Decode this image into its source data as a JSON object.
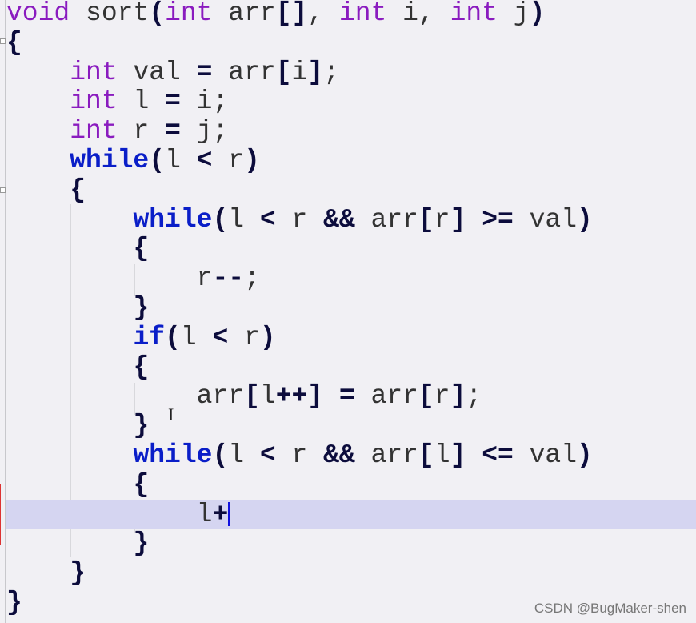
{
  "editor": {
    "current_line": 17,
    "colors": {
      "background": "#f1f0f4",
      "type_keyword": "#8a1bbf",
      "control_keyword": "#0a1ec8",
      "operator": "#0c0c3c",
      "current_line": "#d5d5f1"
    },
    "lines": [
      [
        [
          "kw",
          "void"
        ],
        [
          "t",
          " sort"
        ],
        [
          "op",
          "("
        ],
        [
          "kw",
          "int"
        ],
        [
          "t",
          " arr"
        ],
        [
          "op",
          "[]"
        ],
        [
          "t",
          ", "
        ],
        [
          "kw",
          "int"
        ],
        [
          "t",
          " i, "
        ],
        [
          "kw",
          "int"
        ],
        [
          "t",
          " j"
        ],
        [
          "op",
          ")"
        ]
      ],
      [
        [
          "op",
          "{"
        ]
      ],
      [
        [
          "t",
          "    "
        ],
        [
          "kw",
          "int"
        ],
        [
          "t",
          " val "
        ],
        [
          "op",
          "="
        ],
        [
          "t",
          " arr"
        ],
        [
          "op",
          "["
        ],
        [
          "t",
          "i"
        ],
        [
          "op",
          "]"
        ],
        [
          "t",
          ";"
        ]
      ],
      [
        [
          "t",
          "    "
        ],
        [
          "kw",
          "int"
        ],
        [
          "t",
          " l "
        ],
        [
          "op",
          "="
        ],
        [
          "t",
          " i;"
        ]
      ],
      [
        [
          "t",
          "    "
        ],
        [
          "kw",
          "int"
        ],
        [
          "t",
          " r "
        ],
        [
          "op",
          "="
        ],
        [
          "t",
          " j;"
        ]
      ],
      [
        [
          "t",
          "    "
        ],
        [
          "ctl",
          "while"
        ],
        [
          "op",
          "("
        ],
        [
          "t",
          "l "
        ],
        [
          "op",
          "<"
        ],
        [
          "t",
          " r"
        ],
        [
          "op",
          ")"
        ]
      ],
      [
        [
          "t",
          "    "
        ],
        [
          "op",
          "{"
        ]
      ],
      [
        [
          "t",
          "        "
        ],
        [
          "ctl",
          "while"
        ],
        [
          "op",
          "("
        ],
        [
          "t",
          "l "
        ],
        [
          "op",
          "<"
        ],
        [
          "t",
          " r "
        ],
        [
          "op",
          "&&"
        ],
        [
          "t",
          " arr"
        ],
        [
          "op",
          "["
        ],
        [
          "t",
          "r"
        ],
        [
          "op",
          "]"
        ],
        [
          "t",
          " "
        ],
        [
          "op",
          ">="
        ],
        [
          "t",
          " val"
        ],
        [
          "op",
          ")"
        ]
      ],
      [
        [
          "t",
          "        "
        ],
        [
          "op",
          "{"
        ]
      ],
      [
        [
          "t",
          "            r"
        ],
        [
          "op",
          "--"
        ],
        [
          "t",
          ";"
        ]
      ],
      [
        [
          "t",
          "        "
        ],
        [
          "op",
          "}"
        ]
      ],
      [
        [
          "t",
          "        "
        ],
        [
          "ctl",
          "if"
        ],
        [
          "op",
          "("
        ],
        [
          "t",
          "l "
        ],
        [
          "op",
          "<"
        ],
        [
          "t",
          " r"
        ],
        [
          "op",
          ")"
        ]
      ],
      [
        [
          "t",
          "        "
        ],
        [
          "op",
          "{"
        ]
      ],
      [
        [
          "t",
          "            arr"
        ],
        [
          "op",
          "["
        ],
        [
          "t",
          "l"
        ],
        [
          "op",
          "++]"
        ],
        [
          "t",
          " "
        ],
        [
          "op",
          "="
        ],
        [
          "t",
          " arr"
        ],
        [
          "op",
          "["
        ],
        [
          "t",
          "r"
        ],
        [
          "op",
          "]"
        ],
        [
          "t",
          ";"
        ]
      ],
      [
        [
          "t",
          "        "
        ],
        [
          "op",
          "}"
        ]
      ],
      [
        [
          "t",
          "        "
        ],
        [
          "ctl",
          "while"
        ],
        [
          "op",
          "("
        ],
        [
          "t",
          "l "
        ],
        [
          "op",
          "<"
        ],
        [
          "t",
          " r "
        ],
        [
          "op",
          "&&"
        ],
        [
          "t",
          " arr"
        ],
        [
          "op",
          "["
        ],
        [
          "t",
          "l"
        ],
        [
          "op",
          "]"
        ],
        [
          "t",
          " "
        ],
        [
          "op",
          "<="
        ],
        [
          "t",
          " val"
        ],
        [
          "op",
          ")"
        ]
      ],
      [
        [
          "t",
          "        "
        ],
        [
          "op",
          "{"
        ]
      ],
      [
        [
          "t",
          "            l"
        ],
        [
          "op",
          "+"
        ]
      ],
      [
        [
          "t",
          "        "
        ],
        [
          "op",
          "}"
        ]
      ],
      [
        [
          "t",
          "    "
        ],
        [
          "op",
          "}"
        ]
      ],
      [
        [
          "op",
          "}"
        ]
      ]
    ]
  },
  "watermark": "CSDN @BugMaker-shen"
}
